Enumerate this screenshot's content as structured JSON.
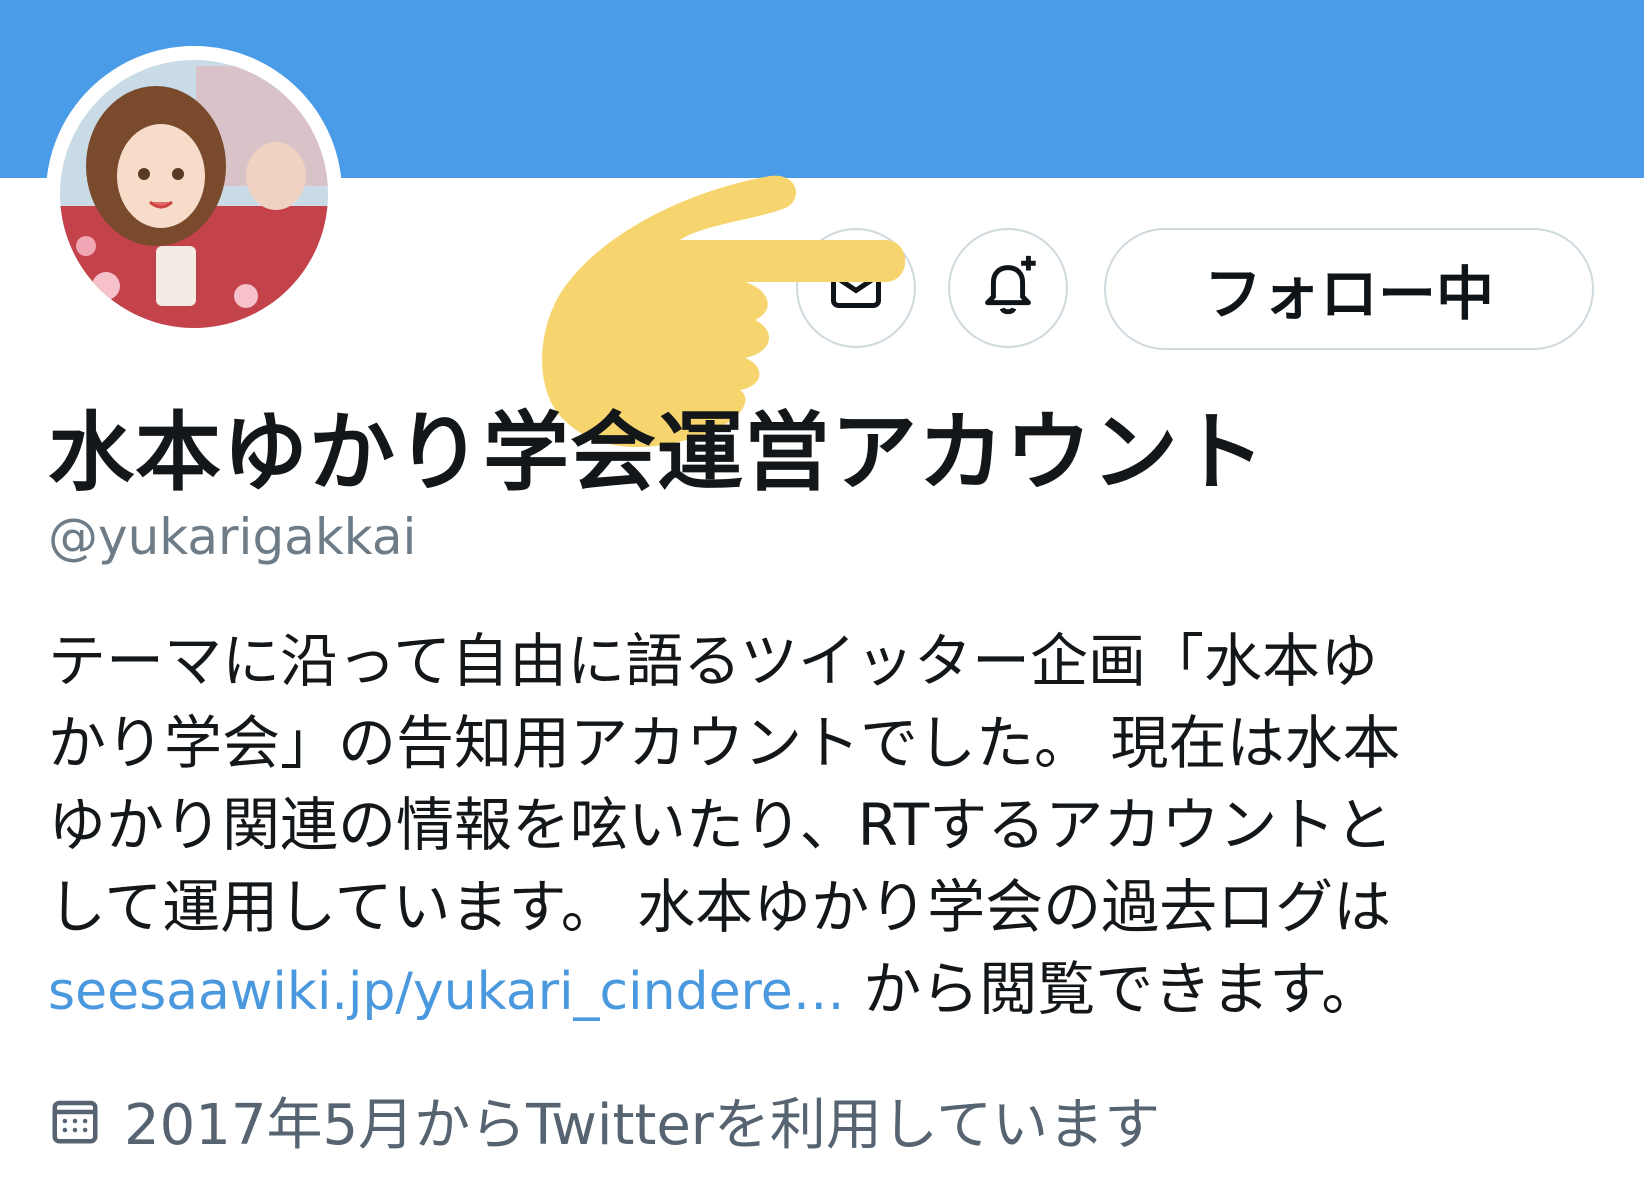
{
  "colors": {
    "banner": "#4a9be8",
    "link": "#4a98dd",
    "muted": "#6e7c88",
    "hand": "#f7d56e"
  },
  "profile": {
    "display_name": "水本ゆかり学会運営アカウント",
    "handle": "@yukarigakkai",
    "avatar_icon": "avatar-illustration"
  },
  "actions": {
    "message_icon": "envelope-icon",
    "notify_icon": "bell-plus-icon",
    "follow_label": "フォロー中"
  },
  "bio": {
    "line1": "テーマに沿って自由に語るツイッター企画「水本ゆ",
    "line2": "かり学会」の告知用アカウントでした。 現在は水本",
    "line3": "ゆかり関連の情報を呟いたり、RTするアカウントと",
    "line4": "して運用しています。 水本ゆかり学会の過去ログは",
    "link": "seesaawiki.jp/yukari_cindere…",
    "line5_suffix": " から閲覧できます。"
  },
  "joined": {
    "icon": "calendar-icon",
    "text": "2017年5月からTwitterを利用しています"
  }
}
